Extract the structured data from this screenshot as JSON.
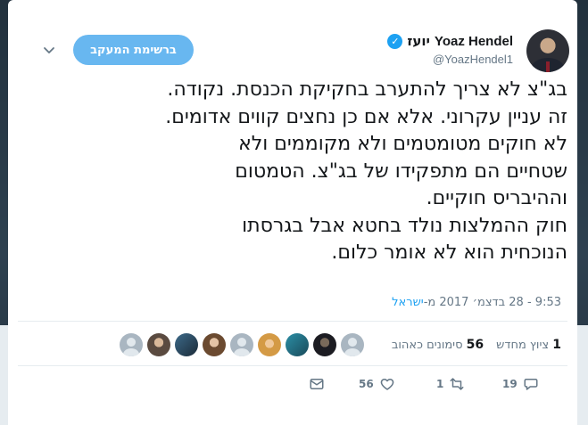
{
  "user": {
    "name_hebrew": "יועז",
    "name_latin": "Yoaz Hendel",
    "handle": "@YoazHendel1",
    "verified_glyph": "✓"
  },
  "follow_button": {
    "label": "ברשימת המעקב"
  },
  "tweet": {
    "lines": [
      "בג\"צ לא צריך להתערב בחקיקת הכנסת. נקודה.",
      "זה עניין עקרוני. אלא אם כן נחצים קווים אדומים.",
      "לא חוקים מטומטמים ולא מקוממים ולא",
      "שטחיים הם מתפקידו של בג\"צ. הטמטום",
      "וההיבריס חוקיים.",
      "חוק ההמלצות נולד בחטא אבל בגרסתו",
      "הנוכחית הוא לא אומר כלום."
    ],
    "timestamp": "9:53 - 28 בדצמ׳ 2017 מ-",
    "location": "ישראל"
  },
  "stats": {
    "retweets_count": "1",
    "retweets_label": "ציוץ מחדש",
    "likes_count": "56",
    "likes_label": "סימונים כאהוב"
  },
  "actions": {
    "reply_count": "19",
    "retweet_count": "1",
    "like_count": "56"
  },
  "colors": {
    "accent": "#1da1f2",
    "button_bg": "#68b7f0",
    "text": "#14171a",
    "muted": "#657786"
  }
}
